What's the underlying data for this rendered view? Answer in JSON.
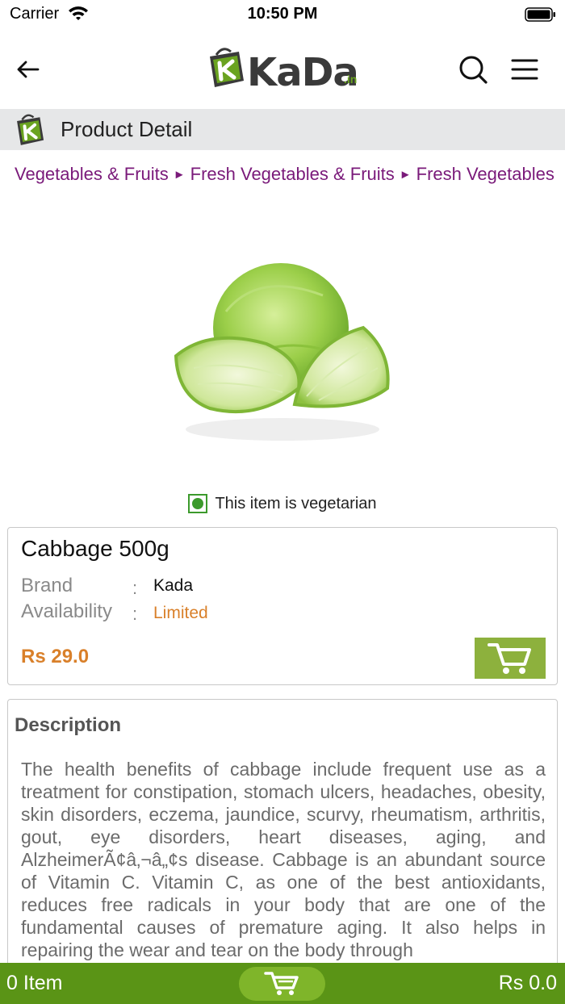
{
  "status_bar": {
    "carrier": "Carrier",
    "time": "10:50 PM"
  },
  "header": {
    "logo_text": "KaDa",
    "logo_tld": ".in",
    "back_icon": "arrow-left-icon",
    "search_icon": "search-icon",
    "menu_icon": "hamburger-menu-icon"
  },
  "section": {
    "title": "Product Detail",
    "icon": "kada-bag-icon"
  },
  "breadcrumb": {
    "items": [
      "Vegetables & Fruits",
      "Fresh Vegetables & Fruits",
      "Fresh Vegetables"
    ],
    "separator": "►",
    "color": "#7a1a7a"
  },
  "product": {
    "image_description": "cabbage",
    "veg_label": "This item is vegetarian",
    "name": "Cabbage 500g",
    "brand_label": "Brand",
    "brand_value": "Kada",
    "availability_label": "Availability",
    "availability_value": "Limited",
    "separator": ":",
    "price": "Rs 29.0",
    "add_to_cart_icon": "cart-icon"
  },
  "description": {
    "title": "Description",
    "text": "The health benefits of cabbage include frequent use as a treatment for constipation, stomach ulcers, headaches, obesity, skin disorders, eczema, jaundice, scurvy, rheumatism, arthritis, gout, eye disorders, heart diseases, aging, and AlzheimerÃ¢â‚¬â„¢s disease. Cabbage is an abundant source of Vitamin C. Vitamin C, as one of the best antioxidants, reduces free radicals in your body that are one of the fundamental causes of premature aging. It also helps in repairing the wear and tear on the body through"
  },
  "cart_bar": {
    "count": "0 Item",
    "total": "Rs 0.0",
    "cart_icon": "cart-icon"
  },
  "colors": {
    "accent_green": "#5a9416",
    "price_orange": "#d9802a",
    "breadcrumb_purple": "#7a1a7a",
    "veg_green": "#3c9a2c"
  }
}
